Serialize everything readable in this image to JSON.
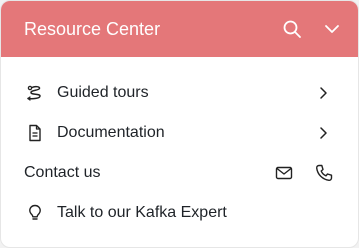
{
  "header": {
    "title": "Resource Center",
    "background": "#e47779",
    "icons": [
      "search-icon",
      "chevron-down-icon"
    ]
  },
  "items": [
    {
      "label": "Guided tours",
      "icon": "guided-tours-icon",
      "trailing_icon": "chevron-right-icon"
    },
    {
      "label": "Documentation",
      "icon": "document-icon",
      "trailing_icon": "chevron-right-icon"
    },
    {
      "label": "Contact us",
      "trailing_icons": [
        "mail-icon",
        "phone-icon"
      ]
    },
    {
      "label": "Talk to our Kafka Expert",
      "icon": "lightbulb-icon"
    }
  ],
  "colors": {
    "text": "#1f2328",
    "icon": "#222222"
  }
}
